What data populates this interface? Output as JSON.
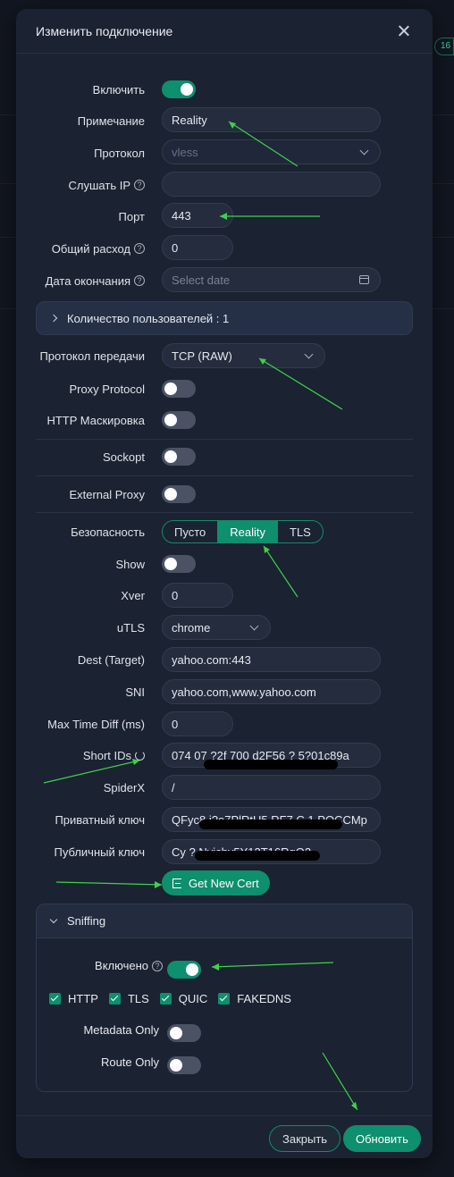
{
  "modal": {
    "title": "Изменить подключение"
  },
  "form": {
    "enable_label": "Включить",
    "remark_label": "Примечание",
    "remark_value": "Reality",
    "protocol_label": "Протокол",
    "protocol_value": "vless",
    "listen_ip_label": "Слушать IP",
    "listen_ip_value": "",
    "port_label": "Порт",
    "port_value": "443",
    "traffic_label": "Общий расход",
    "traffic_value": "0",
    "expiry_label": "Дата окончания",
    "expiry_placeholder": "Select date",
    "clients_label": "Количество пользователей : 1",
    "transport_label": "Протокол передачи",
    "transport_value": "TCP (RAW)",
    "proxy_protocol_label": "Proxy Protocol",
    "http_masking_label": "HTTP Маскировка",
    "sockopt_label": "Sockopt",
    "external_proxy_label": "External Proxy",
    "security_label": "Безопасность",
    "security_options": [
      "Пусто",
      "Reality",
      "TLS"
    ],
    "show_label": "Show",
    "xver_label": "Xver",
    "xver_value": "0",
    "utls_label": "uTLS",
    "utls_value": "chrome",
    "dest_label": "Dest (Target)",
    "dest_value": "yahoo.com:443",
    "sni_label": "SNI",
    "sni_value": "yahoo.com,www.yahoo.com",
    "max_time_diff_label": "Max Time Diff (ms)",
    "max_time_diff_value": "0",
    "short_ids_label": "Short IDs",
    "short_ids_value": "074   07    ?2f 700 d2F56  ?   5?01c89a",
    "spiderx_label": "SpiderX",
    "spiderx_value": "/",
    "private_key_label": "Приватный ключ",
    "private_key_value": "QFyc8  i?o7PlRtU5  RF7     C  1  PQCCMp",
    "public_key_label": "Публичный ключ",
    "public_key_value": "Cy         ?    Nvichv5Y12T16RgQ2",
    "get_cert_label": "Get New Cert"
  },
  "sniffing": {
    "title": "Sniffing",
    "enabled_label": "Включено",
    "options": [
      "HTTP",
      "TLS",
      "QUIC",
      "FAKEDNS"
    ],
    "metadata_only_label": "Metadata Only",
    "route_only_label": "Route Only"
  },
  "footer": {
    "close_label": "Закрыть",
    "update_label": "Обновить"
  },
  "background": {
    "badge_text": "16"
  },
  "colors": {
    "accent": "#0e8f6e",
    "panel_bg": "#1b2231",
    "annotation_arrow": "#3fd14a"
  }
}
